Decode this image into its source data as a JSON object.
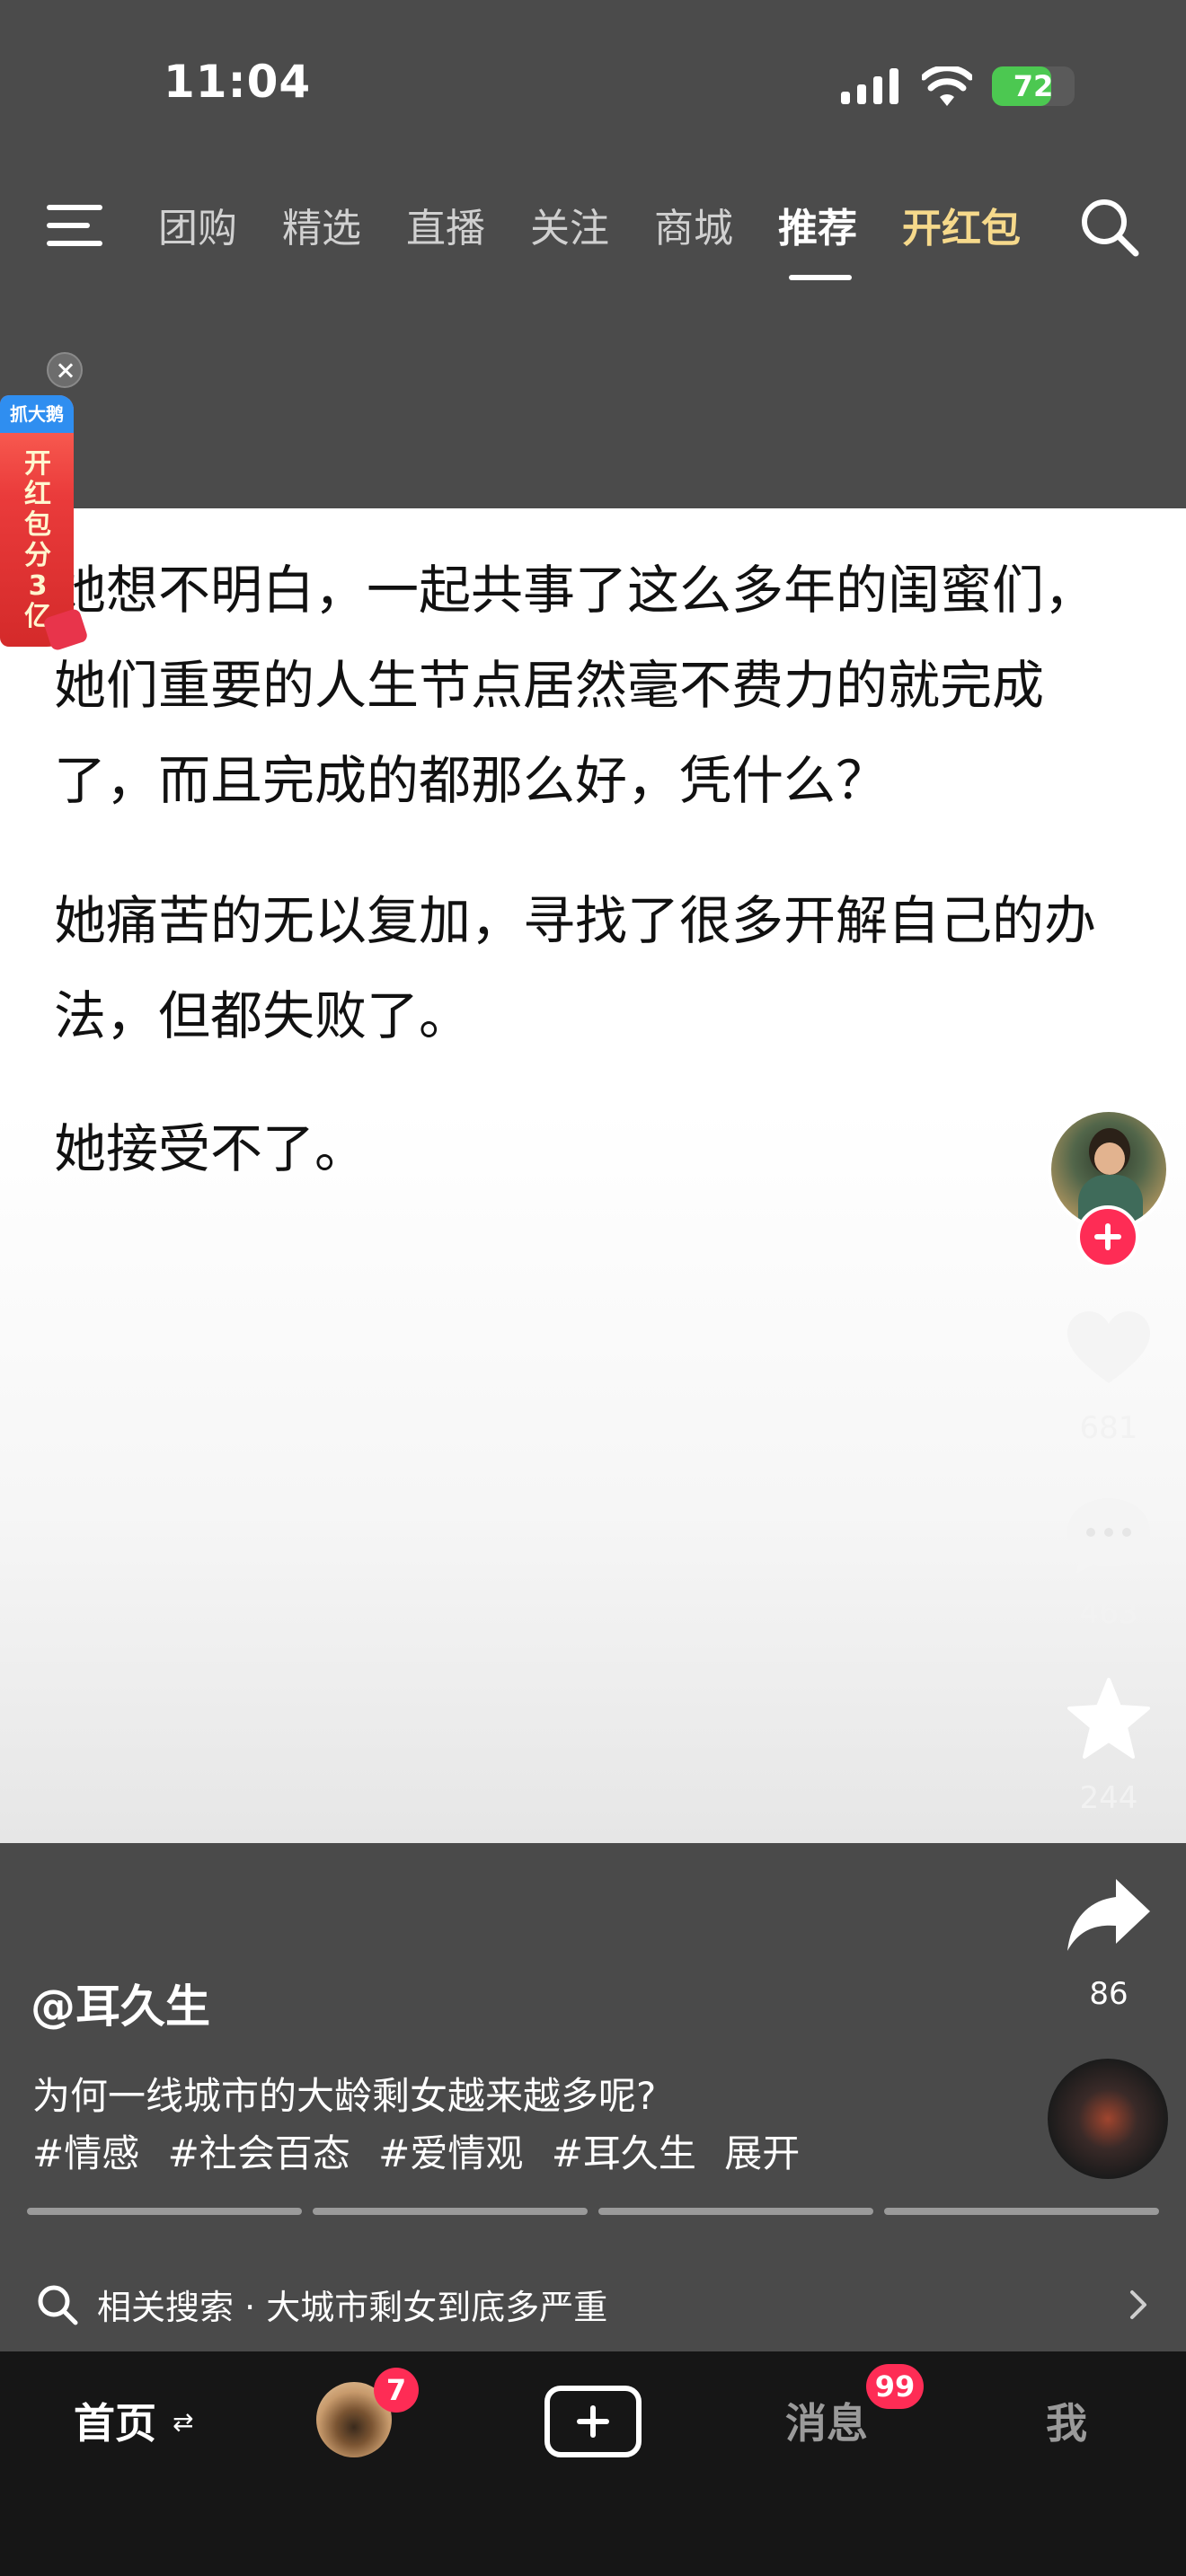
{
  "status_bar": {
    "time": "11:04",
    "battery": "72",
    "battery_level": 0.72
  },
  "top_tabs": [
    {
      "label": "团购"
    },
    {
      "label": "精选"
    },
    {
      "label": "直播"
    },
    {
      "label": "关注"
    },
    {
      "label": "商城"
    },
    {
      "label": "推荐"
    },
    {
      "label": "开红包"
    }
  ],
  "red_packet": {
    "brand": "抓大鹅",
    "text": "开红包分3亿"
  },
  "content": {
    "paragraphs": [
      "她想不明白，一起共事了这么多年的闺蜜们，她们重要的人生节点居然毫不费力的就完成了，而且完成的都那么好，凭什么？",
      "她痛苦的无以复加，寻找了很多开解自己的办法，但都失败了。",
      "她接受不了。"
    ]
  },
  "actions": {
    "like_count": "681",
    "comment_count": "463",
    "favorite_count": "244",
    "share_count": "86"
  },
  "video": {
    "author": "@耳久生",
    "description": "为何一线城市的大龄剩女越来越多呢?",
    "tags": [
      "#情感",
      "#社会百态",
      "#爱情观",
      "#耳久生"
    ],
    "expand": "展开"
  },
  "related_search": {
    "prefix": "相关搜索",
    "separator": "·",
    "query": "大城市剩女到底多严重"
  },
  "bottom_nav": {
    "home": "首页",
    "home_switch": "⇄",
    "friend_badge": "7",
    "messages": "消息",
    "messages_badge": "99",
    "me": "我"
  }
}
